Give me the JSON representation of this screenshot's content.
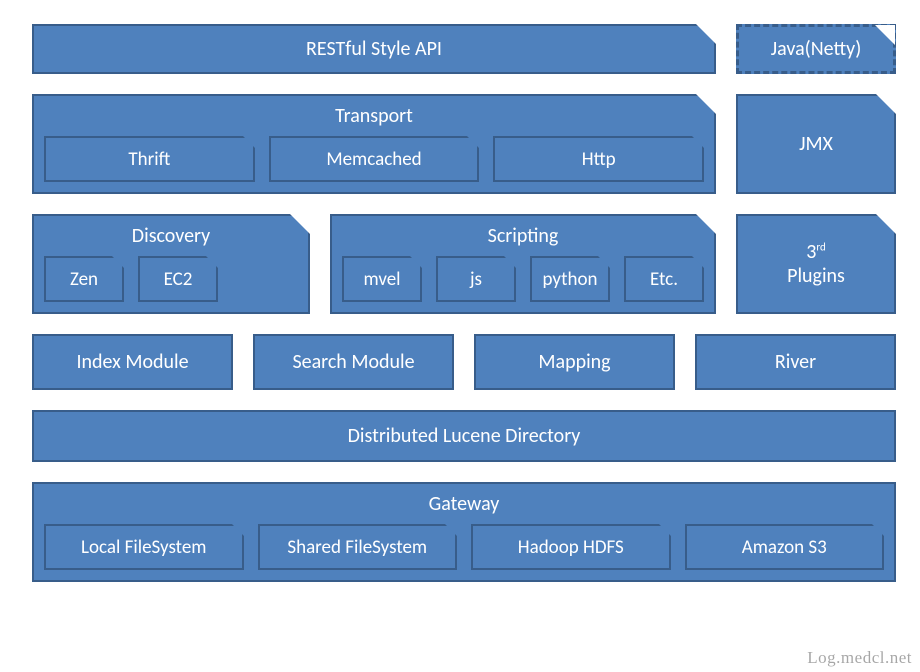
{
  "row1": {
    "restful": "RESTful Style API",
    "java_netty": "Java(Netty)"
  },
  "transport": {
    "title": "Transport",
    "items": [
      "Thrift",
      "Memcached",
      "Http"
    ]
  },
  "jmx": "JMX",
  "discovery": {
    "title": "Discovery",
    "items": [
      "Zen",
      "EC2"
    ]
  },
  "scripting": {
    "title": "Scripting",
    "items": [
      "mvel",
      "js",
      "python",
      "Etc."
    ]
  },
  "third_plugins_pre": "3",
  "third_plugins_sup": "rd",
  "third_plugins_post": "Plugins",
  "row4": {
    "index_module": "Index Module",
    "search_module": "Search Module",
    "mapping": "Mapping",
    "river": "River"
  },
  "dld": "Distributed Lucene Directory",
  "gateway": {
    "title": "Gateway",
    "items": [
      "Local FileSystem",
      "Shared FileSystem",
      "Hadoop HDFS",
      "Amazon S3"
    ]
  },
  "watermark": "Log.medcl.net"
}
